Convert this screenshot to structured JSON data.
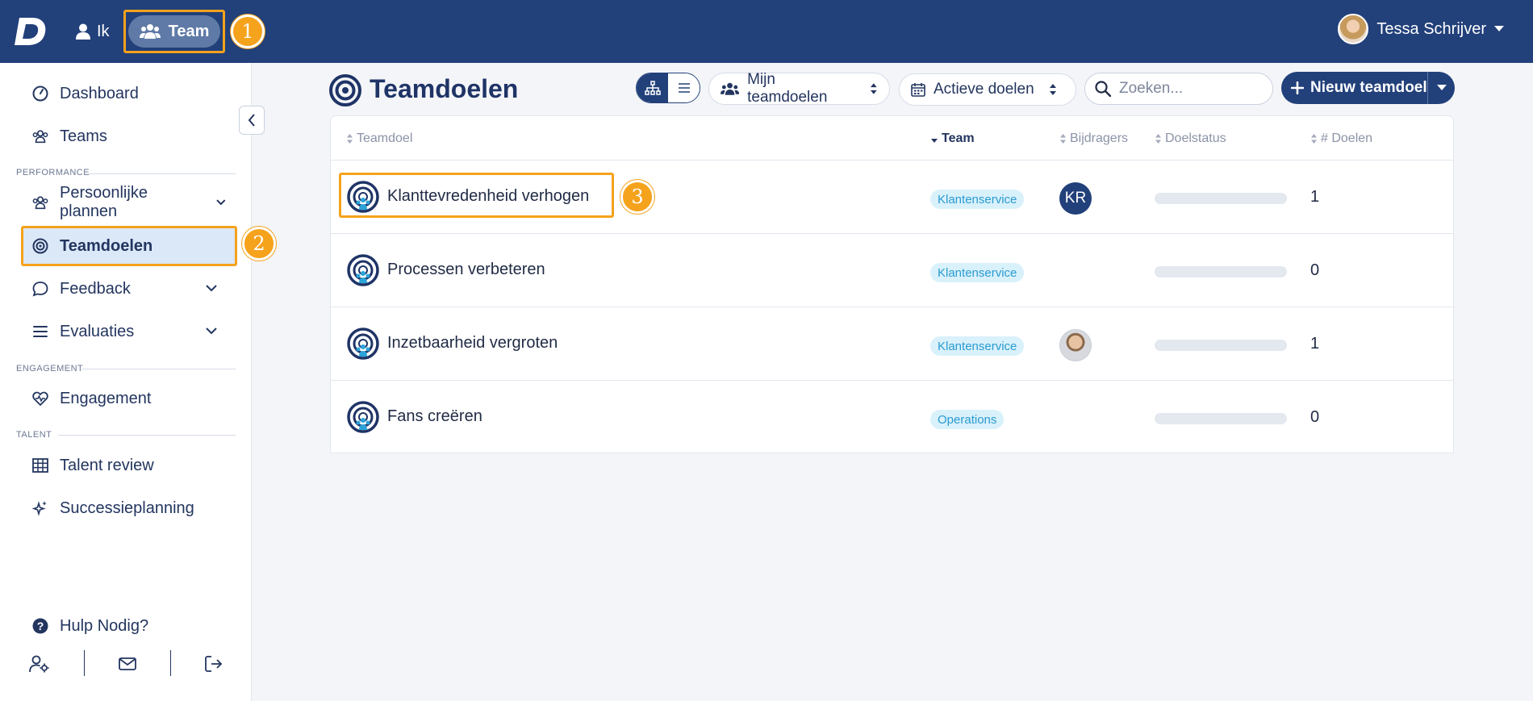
{
  "topbar": {
    "nav_ik": "Ik",
    "nav_team": "Team",
    "user_name": "Tessa Schrijver"
  },
  "steps": [
    "1",
    "2",
    "3"
  ],
  "sidebar": {
    "dashboard": "Dashboard",
    "teams": "Teams",
    "section_performance": "PERFORMANCE",
    "persoonlijke_plannen": "Persoonlijke plannen",
    "teamdoelen": "Teamdoelen",
    "feedback": "Feedback",
    "evaluaties": "Evaluaties",
    "section_engagement": "ENGAGEMENT",
    "engagement": "Engagement",
    "section_talent": "TALENT",
    "talent_review": "Talent review",
    "successieplanning": "Successieplanning",
    "help": "Hulp Nodig?"
  },
  "header": {
    "title": "Teamdoelen",
    "filter_owner": "Mijn teamdoelen",
    "filter_status": "Actieve doelen",
    "search_placeholder": "Zoeken...",
    "new_button": "Nieuw teamdoel"
  },
  "table": {
    "columns": {
      "teamdoel": "Teamdoel",
      "team": "Team",
      "bijdragers": "Bijdragers",
      "doelstatus": "Doelstatus",
      "doelen": "# Doelen"
    },
    "rows": [
      {
        "name": "Klanttevredenheid verhogen",
        "team": "Klantenservice",
        "contributor": "KR",
        "progress": 0,
        "count": "1"
      },
      {
        "name": "Processen verbeteren",
        "team": "Klantenservice",
        "contributor": "",
        "progress": 0,
        "count": "0"
      },
      {
        "name": "Inzetbaarheid vergroten",
        "team": "Klantenservice",
        "contributor": "photo",
        "progress": 0,
        "count": "1"
      },
      {
        "name": "Fans creëren",
        "team": "Operations",
        "contributor": "",
        "progress": 0,
        "count": "0"
      }
    ]
  },
  "colors": {
    "topbar": "#22407a",
    "accent_highlight": "#f5a21c",
    "badge_bg": "#d9f1fb",
    "badge_text": "#2a9bd1"
  }
}
